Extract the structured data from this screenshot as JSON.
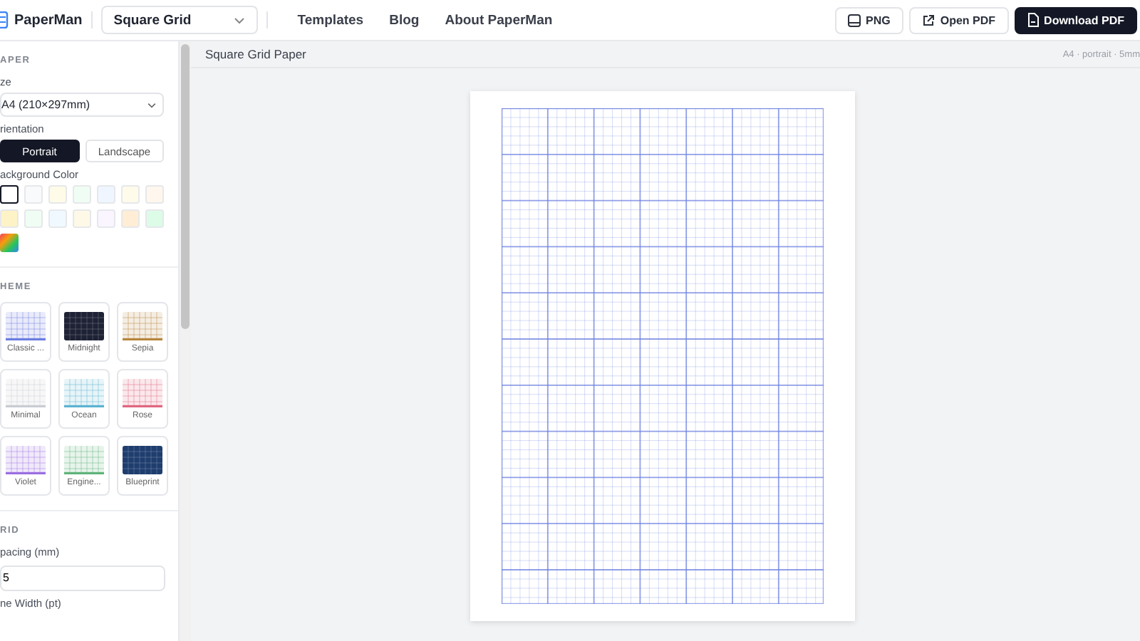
{
  "header": {
    "brand": "PaperMan",
    "template_select": "Square Grid",
    "nav": [
      "Templates",
      "Blog",
      "About PaperMan"
    ],
    "actions": [
      {
        "label": "PNG",
        "kind": "png",
        "primary": false
      },
      {
        "label": "Open PDF",
        "kind": "open",
        "primary": false
      },
      {
        "label": "Download PDF",
        "kind": "download",
        "primary": true
      }
    ]
  },
  "sidebar": {
    "paper_heading": "APER",
    "size_label": "ze",
    "size_value": "A4 (210×297mm)",
    "orientation_label": "rientation",
    "orientations": [
      {
        "label": "Portrait",
        "selected": true
      },
      {
        "label": "Landscape",
        "selected": false
      }
    ],
    "background_label": "ackground Color",
    "swatches": [
      {
        "kind": "solid",
        "color": "#ffffff",
        "selected": true
      },
      {
        "kind": "solid",
        "color": "#f8fafc",
        "selected": false
      },
      {
        "kind": "solid",
        "color": "#fefce8",
        "selected": false
      },
      {
        "kind": "solid",
        "color": "#f0fdf4",
        "selected": false
      },
      {
        "kind": "solid",
        "color": "#eff6ff",
        "selected": false
      },
      {
        "kind": "solid",
        "color": "#fffbeb",
        "selected": false
      },
      {
        "kind": "solid",
        "color": "#fff7ed",
        "selected": false
      },
      {
        "kind": "solid",
        "color": "#fef3c7",
        "selected": false
      },
      {
        "kind": "solid",
        "color": "#f0fdf4",
        "selected": false
      },
      {
        "kind": "solid",
        "color": "#f0f9ff",
        "selected": false
      },
      {
        "kind": "solid",
        "color": "#fef9e7",
        "selected": false
      },
      {
        "kind": "solid",
        "color": "#faf5ff",
        "selected": false
      },
      {
        "kind": "solid",
        "color": "#ffedd5",
        "selected": false
      },
      {
        "kind": "solid",
        "color": "#dcfce7",
        "selected": false
      },
      {
        "kind": "rainbow",
        "selected": false
      }
    ],
    "theme_heading": "HEME",
    "themes": [
      {
        "label": "Classic ...",
        "kind": "light",
        "color": "#6b7ce0"
      },
      {
        "label": "Midnight",
        "kind": "dark",
        "color": "#1e2235"
      },
      {
        "label": "Sepia",
        "kind": "light",
        "color": "#b7853d"
      },
      {
        "label": "Minimal",
        "kind": "light",
        "color": "#c8ccd2"
      },
      {
        "label": "Ocean",
        "kind": "light",
        "color": "#5bb3d0"
      },
      {
        "label": "Rose",
        "kind": "light",
        "color": "#e0667f"
      },
      {
        "label": "Violet",
        "kind": "light",
        "color": "#9b6ee0"
      },
      {
        "label": "Engine...",
        "kind": "light",
        "color": "#5fb37a"
      },
      {
        "label": "Blueprint",
        "kind": "dark",
        "color": "#1f3d6e"
      }
    ],
    "grid_heading": "RID",
    "spacing_label": "pacing (mm)",
    "spacing_value": "5",
    "line_width_label": "ne Width (pt)"
  },
  "preview": {
    "title": "Square Grid Paper",
    "info": "A4 · portrait · 5mm"
  }
}
